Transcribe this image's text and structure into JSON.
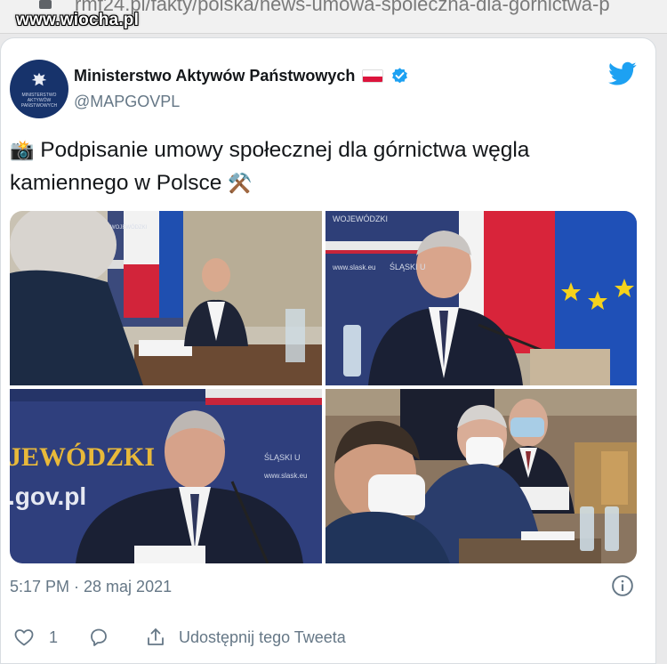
{
  "browser": {
    "url_text": "rmf24.pl/fakty/polska/news-umowa-spoleczna-dla-gornictwa-p",
    "watermark": "www.wiocha.pl"
  },
  "tweet": {
    "author_name": "Ministerstwo Aktywów Państwowych",
    "handle": "@MAPGOVPL",
    "avatar_text": "Ministerstwo Aktywów Państwowych",
    "camera_emoji": "📸",
    "text": "Podpisanie umowy społecznej dla górnictwa węgla kamiennego w Polsce",
    "pick_emoji": "⚒️",
    "timestamp": "5:17 PM · 28 maj 2021",
    "like_count": "1",
    "share_label": "Udostępnij tego Tweeta"
  },
  "photos": {
    "p1": {
      "banner_text": "WOJEWÓDZKI"
    },
    "p2": {
      "banner_top": "WOJEWÓDZKI",
      "banner_mid": "ŚLĄSKI U",
      "banner_url": "www.slask.eu"
    },
    "p3": {
      "banner_big": "JEWÓDZKI",
      "banner_gov": ".gov.pl",
      "banner_side1": "ŚLĄSKI U",
      "banner_side2": "www.slask.eu"
    }
  },
  "colors": {
    "twitter_blue": "#1da1f2",
    "text_secondary": "#657786",
    "ministry_navy": "#17336b"
  },
  "icons": [
    "camera-emoji",
    "pick-emoji",
    "verified-badge-icon",
    "twitter-bird-icon",
    "info-icon",
    "heart-icon",
    "reply-icon",
    "share-icon",
    "poland-flag-icon"
  ]
}
